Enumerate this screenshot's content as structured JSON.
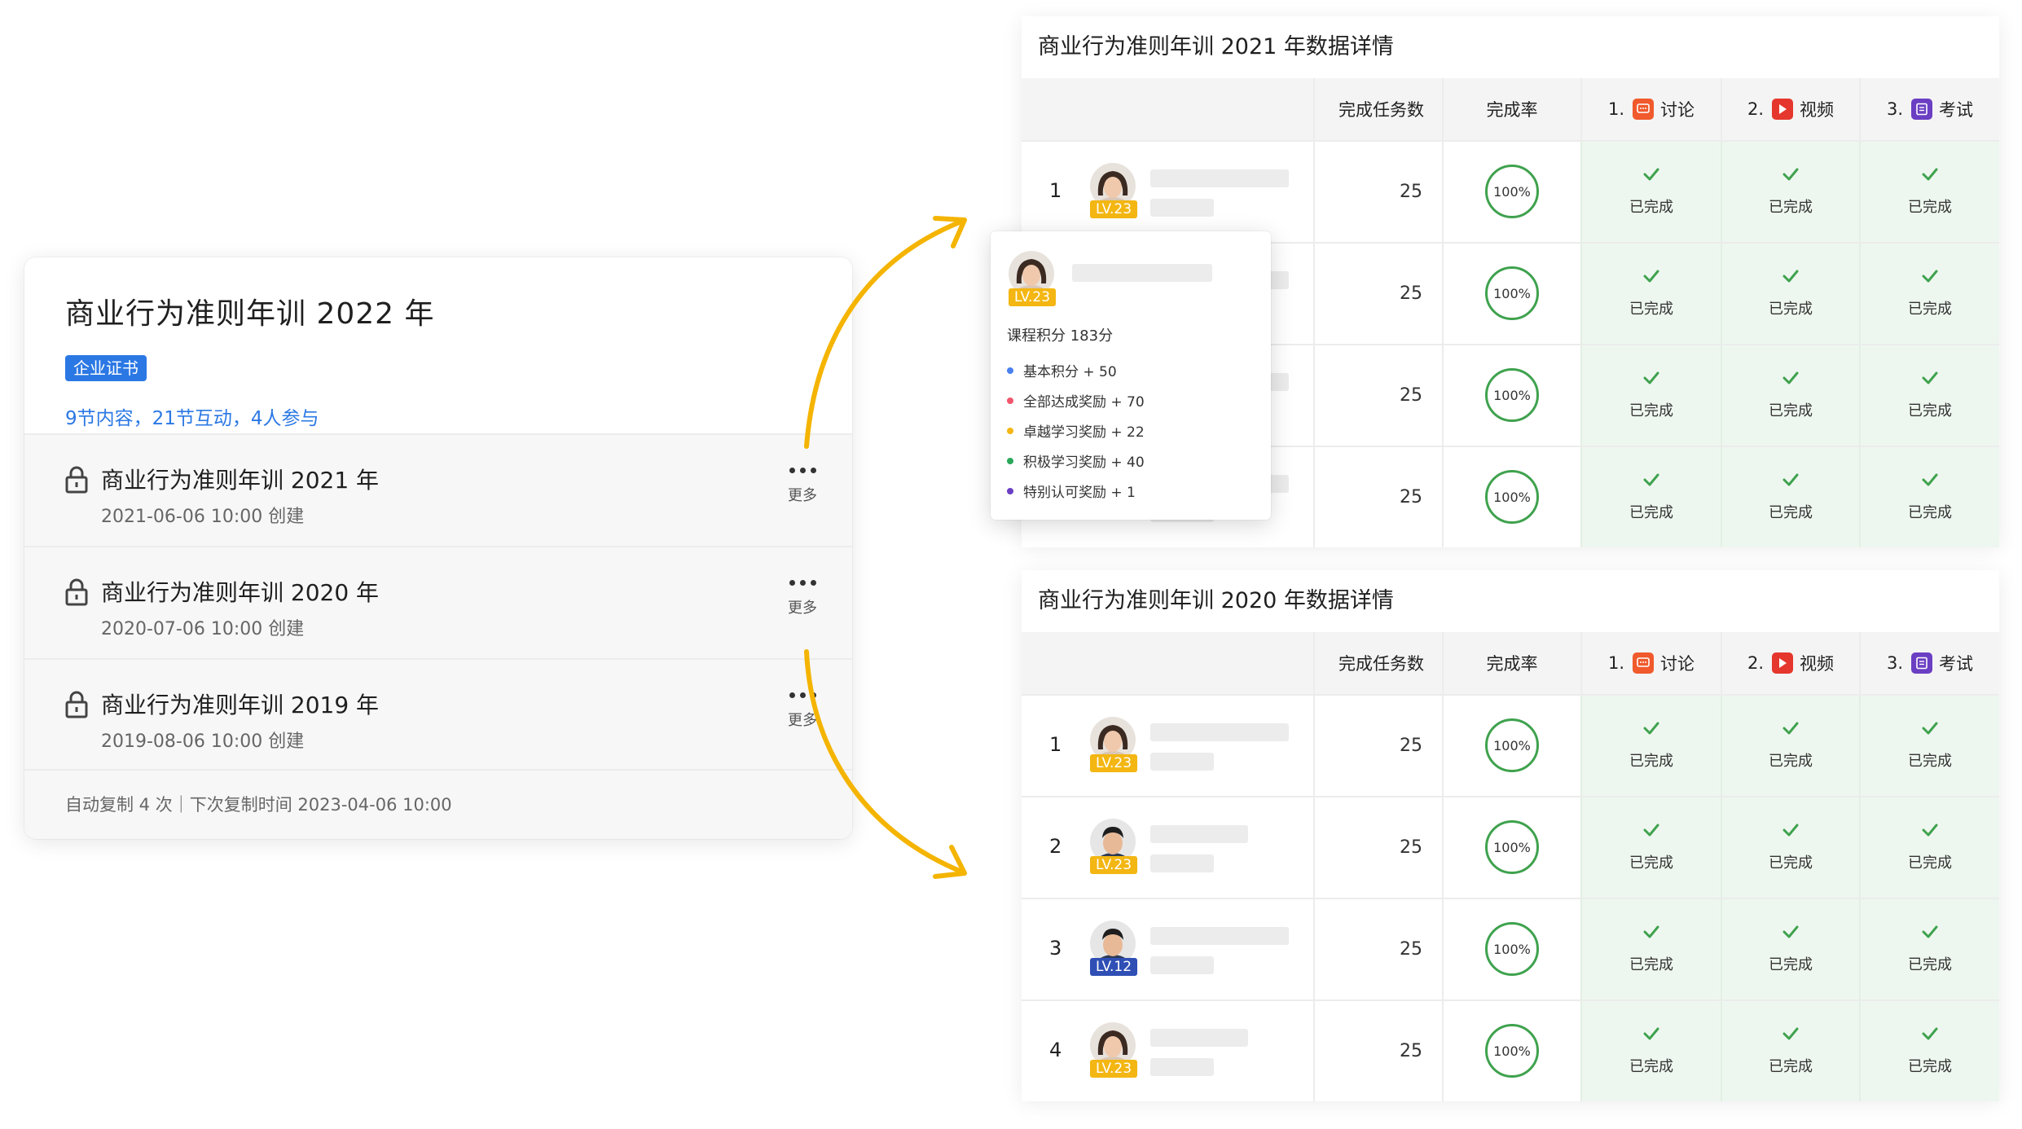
{
  "course": {
    "title": "商业行为准则年训 2022 年",
    "tag": "企业证书",
    "stats": "9节内容，21节互动，4人参与",
    "versions": [
      {
        "title": "商业行为准则年训 2021 年",
        "created": "2021-06-06 10:00 创建",
        "more_label": "更多"
      },
      {
        "title": "商业行为准则年训 2020 年",
        "created": "2020-07-06 10:00 创建",
        "more_label": "更多"
      },
      {
        "title": "商业行为准则年训 2019 年",
        "created": "2019-08-06 10:00 创建",
        "more_label": "更多"
      }
    ],
    "footer": "自动复制 4 次｜下次复制时间 2023-04-06 10:00"
  },
  "table_headers": {
    "tasks": "完成任务数",
    "rate": "完成率",
    "discussion": {
      "num": "1.",
      "label": "讨论"
    },
    "video": {
      "num": "2.",
      "label": "视频"
    },
    "exam": {
      "num": "3.",
      "label": "考试"
    }
  },
  "panels": [
    {
      "title": "商业行为准则年训 2021 年数据详情",
      "rows": [
        {
          "rank": "1",
          "level": "LV.23",
          "level_color": "gold",
          "tasks": "25",
          "rate": "100%",
          "discussion": "已完成",
          "video": "已完成",
          "exam": "已完成"
        },
        {
          "rank": "",
          "level": "",
          "level_color": "gold",
          "tasks": "25",
          "rate": "100%",
          "discussion": "已完成",
          "video": "已完成",
          "exam": "已完成"
        },
        {
          "rank": "",
          "level": "",
          "level_color": "gold",
          "tasks": "25",
          "rate": "100%",
          "discussion": "已完成",
          "video": "已完成",
          "exam": "已完成"
        },
        {
          "rank": "",
          "level": "",
          "level_color": "gold",
          "tasks": "25",
          "rate": "100%",
          "discussion": "已完成",
          "video": "已完成",
          "exam": "已完成"
        }
      ]
    },
    {
      "title": "商业行为准则年训 2020 年数据详情",
      "rows": [
        {
          "rank": "1",
          "level": "LV.23",
          "level_color": "gold",
          "tasks": "25",
          "rate": "100%",
          "discussion": "已完成",
          "video": "已完成",
          "exam": "已完成"
        },
        {
          "rank": "2",
          "level": "LV.23",
          "level_color": "gold",
          "tasks": "25",
          "rate": "100%",
          "discussion": "已完成",
          "video": "已完成",
          "exam": "已完成"
        },
        {
          "rank": "3",
          "level": "LV.12",
          "level_color": "blue",
          "tasks": "25",
          "rate": "100%",
          "discussion": "已完成",
          "video": "已完成",
          "exam": "已完成"
        },
        {
          "rank": "4",
          "level": "LV.23",
          "level_color": "gold",
          "tasks": "25",
          "rate": "100%",
          "discussion": "已完成",
          "video": "已完成",
          "exam": "已完成"
        }
      ]
    }
  ],
  "popover": {
    "level": "LV.23",
    "score": "课程积分 183分",
    "items": [
      {
        "label": "基本积分 + 50",
        "color": "#4a80f0"
      },
      {
        "label": "全部达成奖励 + 70",
        "color": "#f0566b"
      },
      {
        "label": "卓越学习奖励 + 22",
        "color": "#f3b612"
      },
      {
        "label": "积极学习奖励 + 40",
        "color": "#2aa85a"
      },
      {
        "label": "特别认可奖励 + 1",
        "color": "#6b3fc3"
      }
    ]
  },
  "colors": {
    "accent": "#2b78e4",
    "arrow": "#f4b400",
    "success": "#3fa24e"
  }
}
